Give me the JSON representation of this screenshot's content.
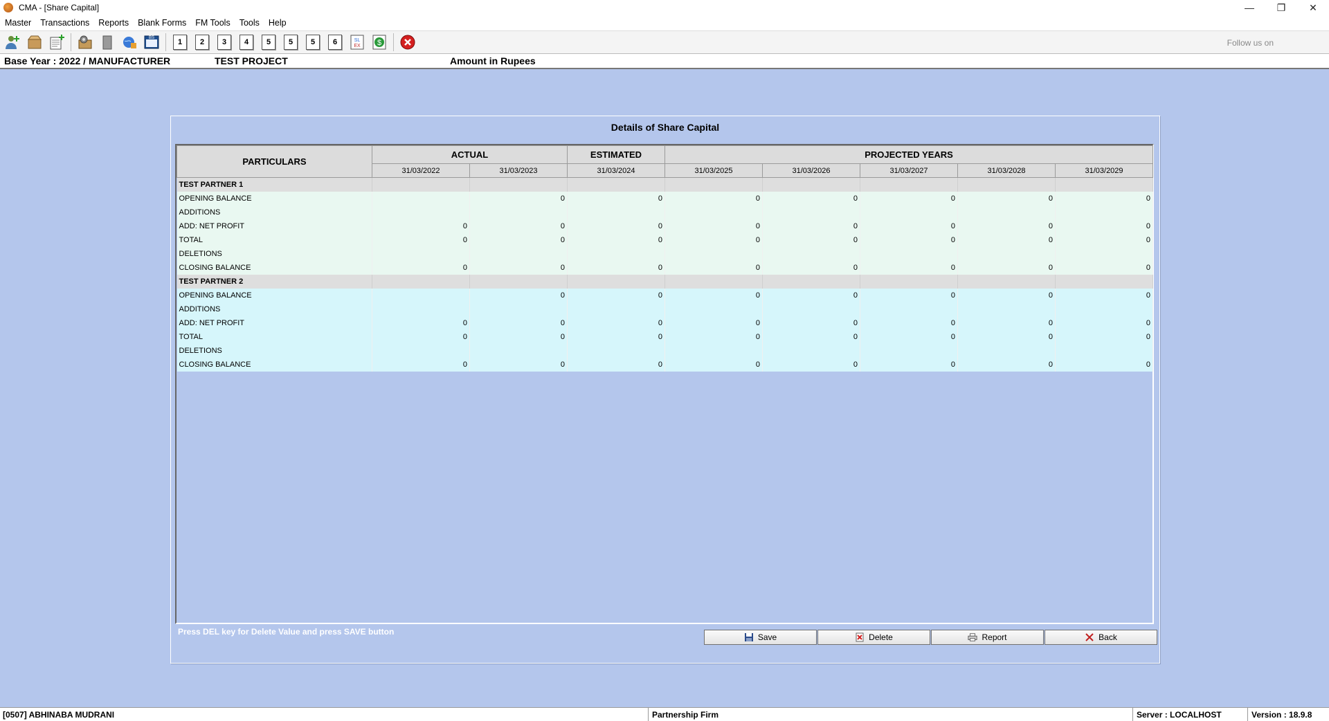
{
  "window": {
    "title": "CMA - [Share Capital]"
  },
  "menu": [
    "Master",
    "Transactions",
    "Reports",
    "Blank Forms",
    "FM Tools",
    "Tools",
    "Help"
  ],
  "toolbar": {
    "numbers": [
      "1",
      "2",
      "3",
      "4",
      "5",
      "5",
      "5",
      "6"
    ],
    "follow_text": "Follow us on"
  },
  "info": {
    "base_year": "Base Year : 2022 / MANUFACTURER",
    "project": "TEST PROJECT",
    "amount": "Amount in Rupees"
  },
  "panel": {
    "title": "Details of Share Capital",
    "hint": "Press DEL key for Delete Value and press SAVE button"
  },
  "grid": {
    "particulars_header": "PARTICULARS",
    "groups": [
      {
        "label": "ACTUAL",
        "span": 2
      },
      {
        "label": "ESTIMATED",
        "span": 1
      },
      {
        "label": "PROJECTED YEARS",
        "span": 5
      }
    ],
    "dates": [
      "31/03/2022",
      "31/03/2023",
      "31/03/2024",
      "31/03/2025",
      "31/03/2026",
      "31/03/2027",
      "31/03/2028",
      "31/03/2029"
    ],
    "sections": [
      {
        "name": "TEST PARTNER 1",
        "style": "p1",
        "rows": [
          {
            "label": "OPENING BALANCE",
            "values": [
              "",
              "0",
              "0",
              "0",
              "0",
              "0",
              "0",
              "0"
            ]
          },
          {
            "label": "ADDITIONS",
            "values": [
              "",
              "",
              "",
              "",
              "",
              "",
              "",
              ""
            ]
          },
          {
            "label": "ADD: NET PROFIT",
            "values": [
              "0",
              "0",
              "0",
              "0",
              "0",
              "0",
              "0",
              "0"
            ]
          },
          {
            "label": "TOTAL",
            "values": [
              "0",
              "0",
              "0",
              "0",
              "0",
              "0",
              "0",
              "0"
            ]
          },
          {
            "label": "DELETIONS",
            "values": [
              "",
              "",
              "",
              "",
              "",
              "",
              "",
              ""
            ]
          },
          {
            "label": "CLOSING BALANCE",
            "values": [
              "0",
              "0",
              "0",
              "0",
              "0",
              "0",
              "0",
              "0"
            ]
          }
        ]
      },
      {
        "name": "TEST PARTNER 2",
        "style": "p2",
        "rows": [
          {
            "label": "OPENING BALANCE",
            "values": [
              "",
              "0",
              "0",
              "0",
              "0",
              "0",
              "0",
              "0"
            ]
          },
          {
            "label": "ADDITIONS",
            "values": [
              "",
              "",
              "",
              "",
              "",
              "",
              "",
              ""
            ]
          },
          {
            "label": "ADD: NET PROFIT",
            "values": [
              "0",
              "0",
              "0",
              "0",
              "0",
              "0",
              "0",
              "0"
            ]
          },
          {
            "label": "TOTAL",
            "values": [
              "0",
              "0",
              "0",
              "0",
              "0",
              "0",
              "0",
              "0"
            ]
          },
          {
            "label": "DELETIONS",
            "values": [
              "",
              "",
              "",
              "",
              "",
              "",
              "",
              ""
            ]
          },
          {
            "label": "CLOSING BALANCE",
            "values": [
              "0",
              "0",
              "0",
              "0",
              "0",
              "0",
              "0",
              "0"
            ]
          }
        ]
      }
    ]
  },
  "buttons": {
    "save": "Save",
    "delete": "Delete",
    "report": "Report",
    "back": "Back"
  },
  "status": {
    "user": "[0507] ABHINABA MUDRANI",
    "firm": "Partnership Firm",
    "server": "Server : LOCALHOST",
    "version": "Version : 18.9.8"
  }
}
